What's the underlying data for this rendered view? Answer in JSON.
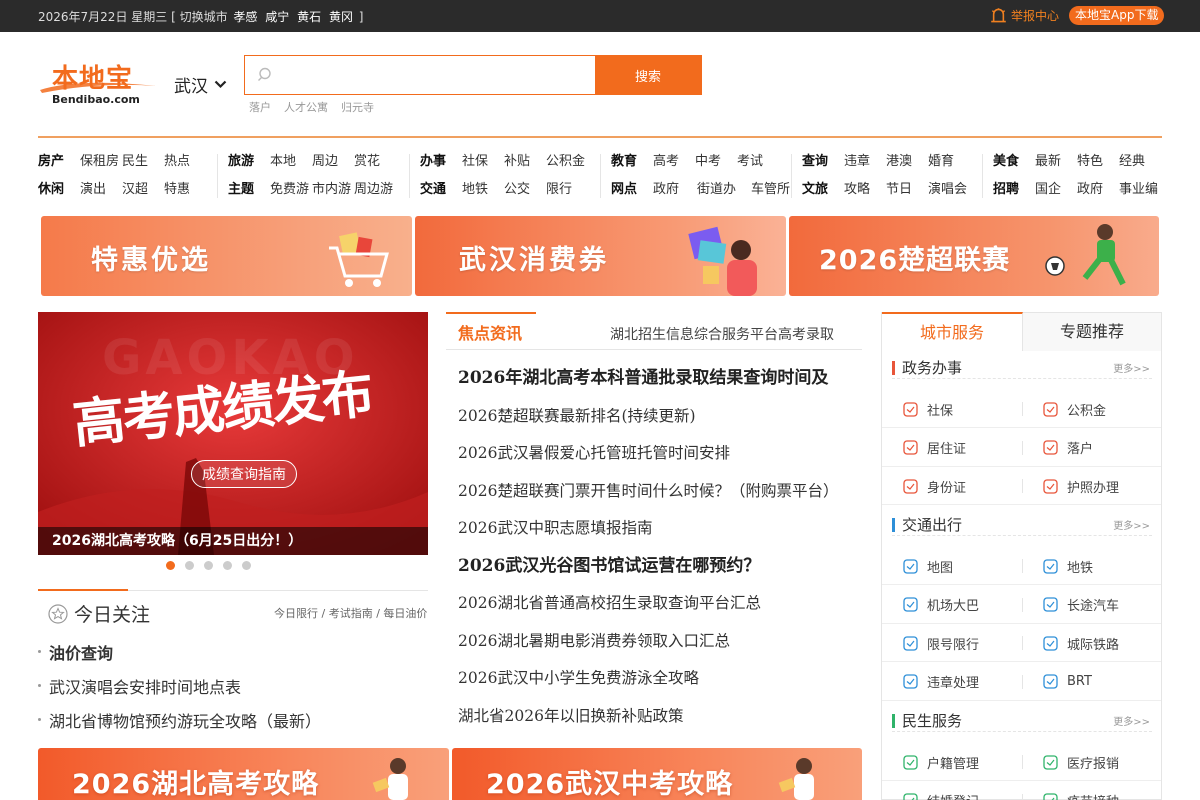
{
  "topbar": {
    "date": "2026年7月22日 星期三",
    "switch_prefix": "[ 切换城市",
    "cities": [
      "孝感",
      "咸宁",
      "黄石",
      "黄冈"
    ],
    "switch_suffix": "]",
    "report_label": "举报中心",
    "app_label": "本地宝App下载"
  },
  "header": {
    "logo_cn": "本地宝",
    "logo_en": "Bendibao.com",
    "city": "武汉",
    "search_placeholder": "",
    "search_button": "搜索",
    "hot_words": [
      "落户",
      "人才公寓",
      "归元寺"
    ]
  },
  "nav": [
    {
      "rows": [
        [
          "房产",
          "保租房",
          "民生",
          "热点"
        ],
        [
          "休闲",
          "演出",
          "汉超",
          "特惠"
        ]
      ]
    },
    {
      "rows": [
        [
          "旅游",
          "本地",
          "周边",
          "赏花"
        ],
        [
          "主题",
          "免费游",
          "市内游",
          "周边游"
        ]
      ]
    },
    {
      "rows": [
        [
          "办事",
          "社保",
          "补贴",
          "公积金"
        ],
        [
          "交通",
          "地铁",
          "公交",
          "限行"
        ]
      ]
    },
    {
      "rows": [
        [
          "教育",
          "高考",
          "中考",
          "考试"
        ],
        [
          "网点",
          "政府",
          "街道办",
          "车管所"
        ]
      ]
    },
    {
      "rows": [
        [
          "查询",
          "违章",
          "港澳",
          "婚育"
        ],
        [
          "文旅",
          "攻略",
          "节日",
          "演唱会"
        ]
      ]
    },
    {
      "rows": [
        [
          "美食",
          "最新",
          "特色",
          "经典"
        ],
        [
          "招聘",
          "国企",
          "政府",
          "事业编"
        ]
      ]
    }
  ],
  "banners": [
    "特惠优选",
    "武汉消费券",
    "2026楚超联赛"
  ],
  "slider": {
    "bg_text": "GAOKAO",
    "headline": "高考成绩发布",
    "guide": "成绩查询指南",
    "caption": "2026湖北高考攻略（6月25日出分！）",
    "dots": 5,
    "active_dot": 1
  },
  "today": {
    "title": "今日关注",
    "links": "今日限行 / 考试指南 / 每日油价",
    "items": [
      {
        "text": "油价查询",
        "bold": true
      },
      {
        "text": "武汉演唱会安排时间地点表",
        "bold": false
      },
      {
        "text": "湖北省博物馆预约游玩全攻略（最新）",
        "bold": false
      }
    ]
  },
  "news": {
    "tab": "焦点资讯",
    "marquee": "湖北招生信息综合服务平台高考录取",
    "items": [
      {
        "text": "2026年湖北高考本科普通批录取结果查询时间及",
        "headline": true
      },
      {
        "text": "2026楚超联赛最新排名(持续更新)",
        "headline": false
      },
      {
        "text": "2026武汉暑假爱心托管班托管时间安排",
        "headline": false
      },
      {
        "text": "2026楚超联赛门票开售时间什么时候？（附购票平台）",
        "headline": false
      },
      {
        "text": "2026武汉中职志愿填报指南",
        "headline": false
      },
      {
        "text": "2026武汉光谷图书馆试运营在哪预约？",
        "headline": true
      },
      {
        "text": "2026湖北省普通高校招生录取查询平台汇总",
        "headline": false
      },
      {
        "text": "2026湖北暑期电影消费券领取入口汇总",
        "headline": false
      },
      {
        "text": "2026武汉中小学生免费游泳全攻略",
        "headline": false
      },
      {
        "text": "湖北省2026年以旧换新补贴政策",
        "headline": false
      }
    ]
  },
  "right_panel": {
    "tab_active": "城市服务",
    "tab_other": "专题推荐",
    "more": "更多>>",
    "sections": [
      {
        "title": "政务办事",
        "color": "#e8553a",
        "rows": [
          [
            "社保",
            "公积金"
          ],
          [
            "居住证",
            "落户"
          ],
          [
            "身份证",
            "护照办理"
          ]
        ]
      },
      {
        "title": "交通出行",
        "color": "#2d8fd8",
        "rows": [
          [
            "地图",
            "地铁"
          ],
          [
            "机场大巴",
            "长途汽车"
          ],
          [
            "限号限行",
            "城际铁路"
          ],
          [
            "违章处理",
            "BRT"
          ]
        ]
      },
      {
        "title": "民生服务",
        "color": "#2fb36a",
        "rows": [
          [
            "户籍管理",
            "医疗报销"
          ],
          [
            "结婚登记",
            "疫苗接种"
          ]
        ]
      }
    ]
  },
  "bottom_banners": [
    "2026湖北高考攻略",
    "2026武汉中考攻略"
  ],
  "colors": {
    "brand": "#f26b1d",
    "topbar": "#2b2b2b"
  }
}
